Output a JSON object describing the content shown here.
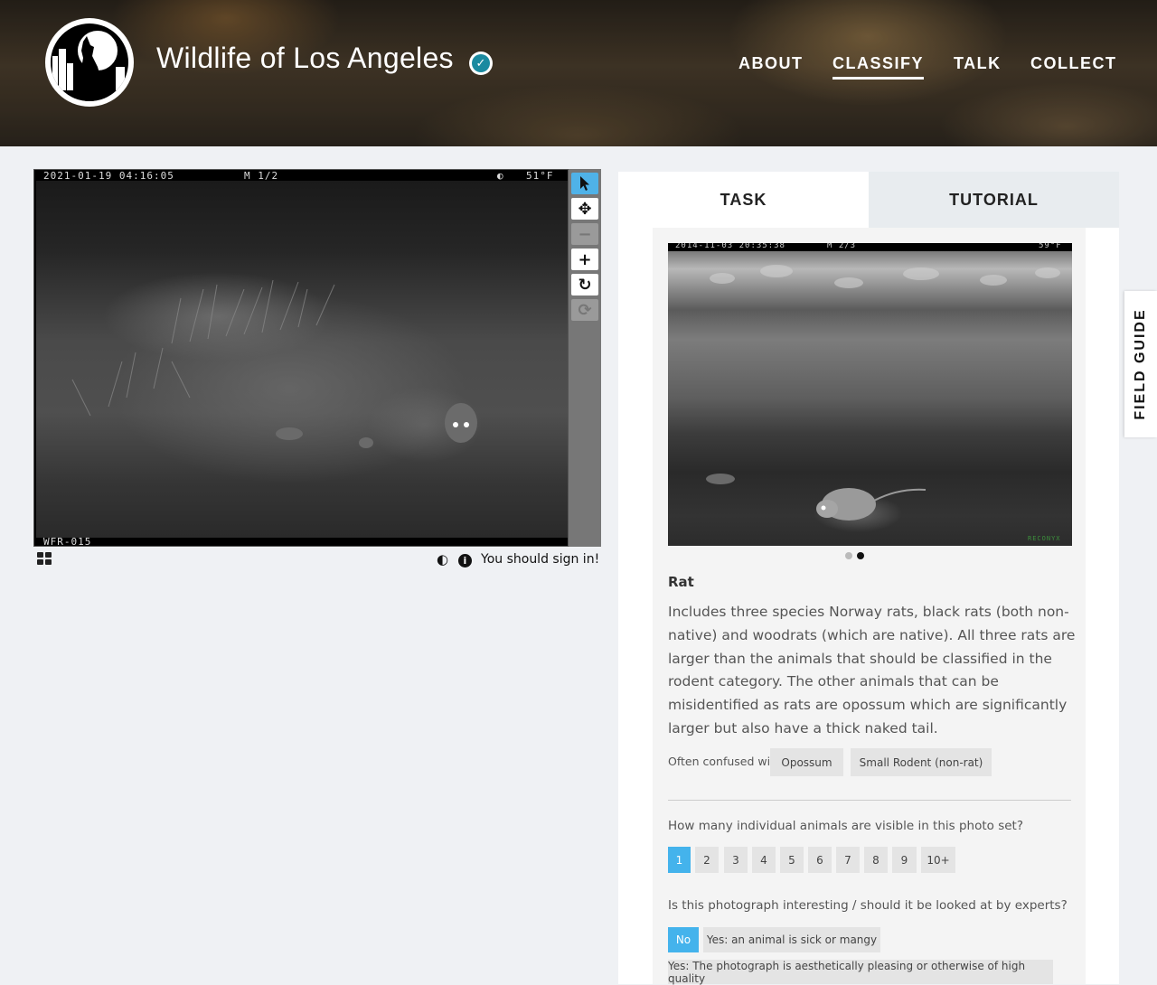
{
  "header": {
    "title": "Wildlife of Los Angeles",
    "nav": [
      {
        "label": "ABOUT",
        "active": false
      },
      {
        "label": "CLASSIFY",
        "active": true
      },
      {
        "label": "TALK",
        "active": false
      },
      {
        "label": "COLLECT",
        "active": false
      }
    ]
  },
  "viewer": {
    "timestamp": "2021-01-19 04:16:05",
    "frame": "M 1/2",
    "moon": "◐",
    "temperature": "51°F",
    "camera_id": "WFR-015",
    "signin_text": "You should sign in!"
  },
  "toolbar": {
    "icons": [
      "pointer-icon",
      "move-icon",
      "zoom-out-icon",
      "zoom-in-icon",
      "rotate-icon",
      "reset-icon"
    ]
  },
  "tabs": {
    "task": "TASK",
    "tutorial": "TUTORIAL"
  },
  "field_guide_tab": "FIELD GUIDE",
  "species": {
    "image_timestamp": "2014-11-03 20:35:38",
    "image_frame": "M 2/3",
    "image_temperature": "59°F",
    "image_brand": "RECONYX",
    "name": "Rat",
    "description": "Includes three species Norway rats, black rats (both non-native) and woodrats (which are native). All three rats are larger than the animals that should be classified in the rodent category. The other animals that can be misidentified as rats are opossum which are significantly larger but also have a thick naked tail.",
    "confused_label": "Often confused with",
    "confused_with": [
      "Opossum",
      "Small Rodent (non-rat)"
    ],
    "active_image_index": 2
  },
  "questions": {
    "count_question": "How many individual animals are visible in this photo set?",
    "count_options": [
      "1",
      "2",
      "3",
      "4",
      "5",
      "6",
      "7",
      "8",
      "9",
      "10+"
    ],
    "count_selected": "1",
    "interesting_question": "Is this photograph interesting / should it be looked at by experts?",
    "interesting_options": [
      "No",
      "Yes: an animal is sick or mangy",
      "Yes: The photograph is aesthetically pleasing or otherwise of high quality"
    ],
    "interesting_selected": "No"
  },
  "colors": {
    "accent": "#44b3ec",
    "verified": "#1a8aa0"
  }
}
